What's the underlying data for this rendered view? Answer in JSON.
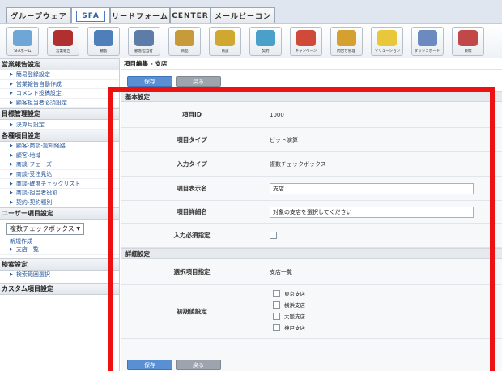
{
  "top_tabs": [
    {
      "label": "グループウェア"
    },
    {
      "label": "SFA"
    },
    {
      "label": "リードフォーム"
    },
    {
      "label": "CENTER"
    },
    {
      "label": "メールビーコン"
    }
  ],
  "toolbar": [
    {
      "label": "SFAホーム",
      "icon": "house-icon",
      "color": "#6ea6d8"
    },
    {
      "label": "営業報告",
      "icon": "check-icon",
      "color": "#b03030"
    },
    {
      "label": "顧客",
      "icon": "person-icon",
      "color": "#4f7fb8"
    },
    {
      "label": "顧客担当者",
      "icon": "people-icon",
      "color": "#5c7da8"
    },
    {
      "label": "商品",
      "icon": "box-icon",
      "color": "#c79a3a"
    },
    {
      "label": "商談",
      "icon": "handshake-icon",
      "color": "#d0a830"
    },
    {
      "label": "契約",
      "icon": "pen-icon",
      "color": "#4aa0c8"
    },
    {
      "label": "キャンペーン",
      "icon": "target-icon",
      "color": "#d04a3a"
    },
    {
      "label": "問合せ管理",
      "icon": "inbox-icon",
      "color": "#d6a030"
    },
    {
      "label": "ソリューション",
      "icon": "bulb-icon",
      "color": "#e8c83a"
    },
    {
      "label": "ダッシュボード",
      "icon": "dashboard-icon",
      "color": "#6a8ac0"
    },
    {
      "label": "目標",
      "icon": "chart-icon",
      "color": "#c04848"
    }
  ],
  "sidebar": {
    "sections": [
      {
        "title": "営業報告設定",
        "items": [
          "簡易登録設定",
          "営業報告自動作成",
          "コメント投稿設定",
          "顧客担当者必須設定"
        ]
      },
      {
        "title": "目標管理設定",
        "items": [
          "決算月設定"
        ]
      },
      {
        "title": "各種項目設定",
        "items": [
          "顧客-商談-認知経路",
          "顧客-地域",
          "商談-フェーズ",
          "商談-受注見込",
          "商談-確度チェックリスト",
          "商談-担当者役割",
          "契約-契約種別"
        ]
      }
    ],
    "user_items": {
      "title": "ユーザー項目設定",
      "select_value": "複数チェックボックス",
      "new_link": "新規作成",
      "items": [
        "支店一覧"
      ]
    },
    "search": {
      "title": "検索設定",
      "items": [
        "検索範囲選択"
      ]
    },
    "custom": {
      "title": "カスタム項目設定"
    }
  },
  "main": {
    "breadcrumb": "項目編集 - 支店",
    "save_label": "保存",
    "back_label": "戻る",
    "basic_header": "基本設定",
    "detail_header": "詳細設定",
    "fields": {
      "id_label": "項目ID",
      "id_value": "1000",
      "type_label": "項目タイプ",
      "type_value": "ビット演算",
      "input_label": "入力タイプ",
      "input_value": "複数チェックボックス",
      "display_label": "項目表示名",
      "display_value": "支店",
      "detail_label": "項目詳細名",
      "detail_value": "対象の支店を選択してください",
      "required_label": "入力必須指定",
      "choice_label": "選択項目指定",
      "choice_value": "支店一覧",
      "initial_label": "初期値設定",
      "options": [
        "東京支店",
        "横浜支店",
        "大阪支店",
        "神戸支店"
      ]
    }
  },
  "colors": {
    "highlight": "#ee1111",
    "accent": "#5a8fd4"
  }
}
